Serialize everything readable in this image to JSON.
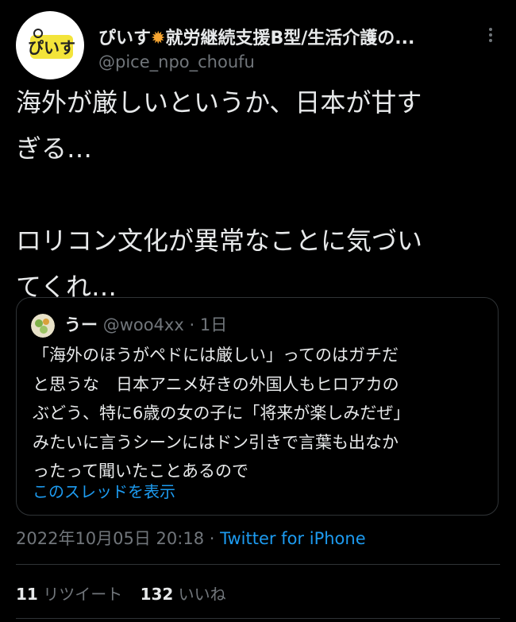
{
  "author": {
    "name": "ぴいす",
    "name_suffix": "就労継続支援B型/生活介護の...",
    "handle": "@pice_npo_choufu",
    "avatar_text": "ぴいす"
  },
  "tweet": {
    "text": "海外が厳しいというか、日本が甘す\nぎる…\n\nロリコン文化が異常なことに気づい\nてくれ…"
  },
  "quote": {
    "name": "うー",
    "handle": "@woo4xx",
    "time": "1日",
    "text": "「海外のほうがペドには厳しい」ってのはガチだ\nと思うな　日本アニメ好きの外国人もヒロアカの\nぶどう、特に6歳の女の子に「将来が楽しみだぜ」\nみたいに言うシーンにはドン引きで言葉も出なか\nったって聞いたことあるので",
    "show_thread": "このスレッドを表示"
  },
  "meta": {
    "timestamp": "2022年10月05日 20:18",
    "separator": " · ",
    "source": "Twitter for iPhone"
  },
  "stats": {
    "retweets_count": "11",
    "retweets_label": "リツイート",
    "likes_count": "132",
    "likes_label": "いいね"
  },
  "icons": {
    "more": "more-icon",
    "star": "sun-emoji-icon"
  }
}
